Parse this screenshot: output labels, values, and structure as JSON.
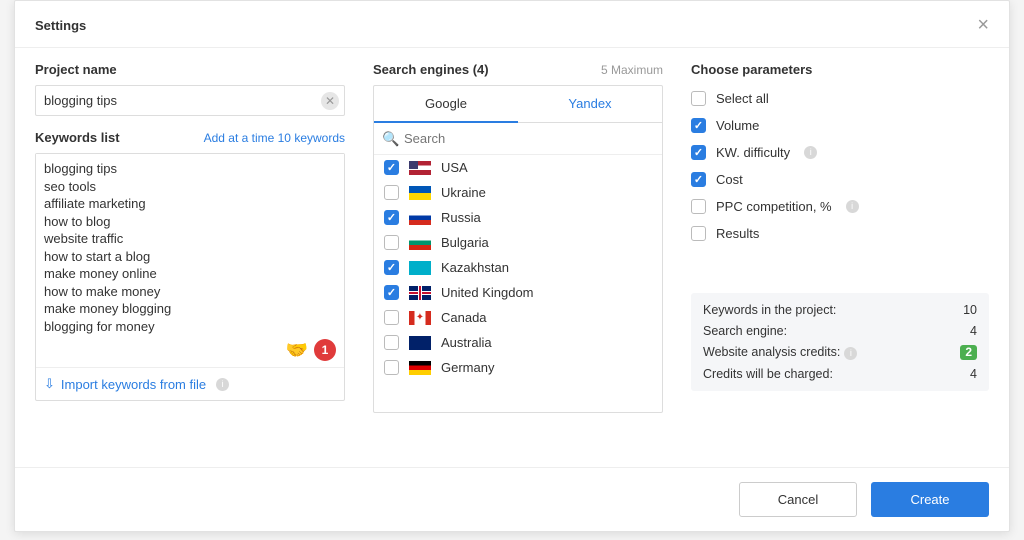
{
  "modal": {
    "title": "Settings",
    "close": "×"
  },
  "project": {
    "label": "Project name",
    "value": "blogging tips"
  },
  "keywords": {
    "label": "Keywords list",
    "hint": "Add at a time 10 keywords",
    "text": "blogging tips\nseo tools\naffiliate marketing\nhow to blog\nwebsite traffic\nhow to start a blog\nmake money online\nhow to make money\nmake money blogging\nblogging for money",
    "handshake": "🤝",
    "count_badge": "1",
    "import_label": "Import keywords from file"
  },
  "engines": {
    "label": "Search engines (4)",
    "hint": "5 Maximum",
    "tabs": {
      "google": "Google",
      "yandex": "Yandex",
      "active": "google"
    },
    "search_placeholder": "Search",
    "items": [
      {
        "name": "USA",
        "checked": true,
        "flag": "usa"
      },
      {
        "name": "Ukraine",
        "checked": false,
        "flag": "ukraine"
      },
      {
        "name": "Russia",
        "checked": true,
        "flag": "russia"
      },
      {
        "name": "Bulgaria",
        "checked": false,
        "flag": "bulgaria"
      },
      {
        "name": "Kazakhstan",
        "checked": true,
        "flag": "kazakhstan"
      },
      {
        "name": "United Kingdom",
        "checked": true,
        "flag": "uk"
      },
      {
        "name": "Canada",
        "checked": false,
        "flag": "canada"
      },
      {
        "name": "Australia",
        "checked": false,
        "flag": "australia"
      },
      {
        "name": "Germany",
        "checked": false,
        "flag": "germany"
      }
    ]
  },
  "params": {
    "label": "Choose parameters",
    "items": [
      {
        "label": "Select all",
        "checked": false,
        "info": false
      },
      {
        "label": "Volume",
        "checked": true,
        "info": false
      },
      {
        "label": "KW. difficulty",
        "checked": true,
        "info": true
      },
      {
        "label": "Cost",
        "checked": true,
        "info": false
      },
      {
        "label": "PPC competition, %",
        "checked": false,
        "info": true
      },
      {
        "label": "Results",
        "checked": false,
        "info": false
      }
    ]
  },
  "summary": {
    "rows": [
      {
        "label": "Keywords in the project:",
        "value": "10",
        "green": false,
        "info": false
      },
      {
        "label": "Search engine:",
        "value": "4",
        "green": false,
        "info": false
      },
      {
        "label": "Website analysis credits:",
        "value": "2",
        "green": true,
        "info": true
      },
      {
        "label": "Credits will be charged:",
        "value": "4",
        "green": false,
        "info": false
      }
    ]
  },
  "footer": {
    "cancel": "Cancel",
    "create": "Create"
  }
}
